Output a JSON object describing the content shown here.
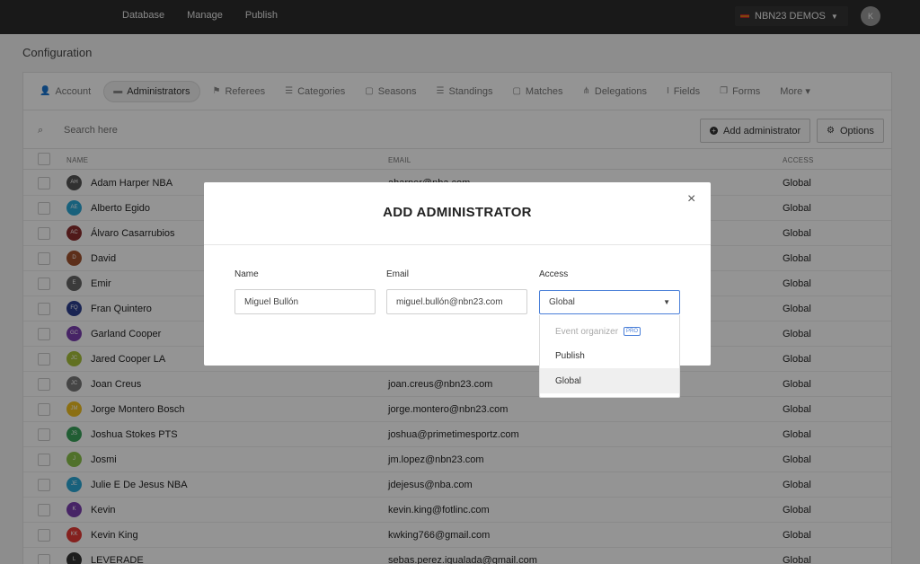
{
  "topnav": [
    "Database",
    "Manage",
    "Publish"
  ],
  "org": {
    "name": "NBN23 DEMOS"
  },
  "user": {
    "initials": "K"
  },
  "page": {
    "title": "Configuration"
  },
  "tabs": [
    {
      "icon": "person",
      "label": "Account"
    },
    {
      "icon": "briefcase",
      "label": "Administrators",
      "active": true
    },
    {
      "icon": "whistle",
      "label": "Referees"
    },
    {
      "icon": "list",
      "label": "Categories"
    },
    {
      "icon": "calendar",
      "label": "Seasons"
    },
    {
      "icon": "list",
      "label": "Standings"
    },
    {
      "icon": "calendar",
      "label": "Matches"
    },
    {
      "icon": "sitemap",
      "label": "Delegations"
    },
    {
      "icon": "i-beam",
      "label": "Fields"
    },
    {
      "icon": "copy",
      "label": "Forms"
    },
    {
      "icon": "",
      "label": "More ▾"
    }
  ],
  "toolbar": {
    "search_placeholder": "Search here",
    "add_label": "Add administrator",
    "options_label": "Options"
  },
  "table": {
    "headers": {
      "name": "NAME",
      "email": "EMAIL",
      "access": "ACCESS"
    },
    "rows": [
      {
        "initials": "AH",
        "color": "#555555",
        "name": "Adam Harper NBA",
        "email": "aharper@nba.com",
        "access": "Global"
      },
      {
        "initials": "AE",
        "color": "#2aa7d6",
        "name": "Alberto Egido",
        "email": "",
        "access": "Global"
      },
      {
        "initials": "AC",
        "color": "#8b2e2e",
        "name": "Álvaro Casarrubios",
        "email": "",
        "access": "Global"
      },
      {
        "initials": "D",
        "color": "#a0522d",
        "name": "David",
        "email": "",
        "access": "Global"
      },
      {
        "initials": "E",
        "color": "#666666",
        "name": "Emir",
        "email": "",
        "access": "Global"
      },
      {
        "initials": "FQ",
        "color": "#2c3e90",
        "name": "Fran Quintero",
        "email": "",
        "access": "Global"
      },
      {
        "initials": "GC",
        "color": "#7b3fb0",
        "name": "Garland Cooper",
        "email": "",
        "access": "Global"
      },
      {
        "initials": "JC",
        "color": "#a8c23a",
        "name": "Jared Cooper LA",
        "email": "",
        "access": "Global"
      },
      {
        "initials": "JC",
        "color": "#777777",
        "name": "Joan Creus",
        "email": "joan.creus@nbn23.com",
        "access": "Global"
      },
      {
        "initials": "JM",
        "color": "#f0c020",
        "name": "Jorge Montero Bosch",
        "email": "jorge.montero@nbn23.com",
        "access": "Global"
      },
      {
        "initials": "JS",
        "color": "#3aa35a",
        "name": "Joshua Stokes PTS",
        "email": "joshua@primetimesportz.com",
        "access": "Global"
      },
      {
        "initials": "J",
        "color": "#8bc34a",
        "name": "Josmi",
        "email": "jm.lopez@nbn23.com",
        "access": "Global"
      },
      {
        "initials": "JE",
        "color": "#2aa7d6",
        "name": "Julie E De Jesus NBA",
        "email": "jdejesus@nba.com",
        "access": "Global"
      },
      {
        "initials": "K",
        "color": "#7b3fb0",
        "name": "Kevin",
        "email": "kevin.king@fotlinc.com",
        "access": "Global"
      },
      {
        "initials": "KK",
        "color": "#e53935",
        "name": "Kevin King",
        "email": "kwking766@gmail.com",
        "access": "Global"
      },
      {
        "initials": "L",
        "color": "#333333",
        "name": "LEVERADE",
        "email": "sebas.perez.igualada@gmail.com",
        "access": "Global"
      }
    ]
  },
  "modal": {
    "title": "ADD ADMINISTRATOR",
    "close": "×",
    "name_label": "Name",
    "name_value": "Miguel Bullón",
    "email_label": "Email",
    "email_value": "miguel.bullón@nbn23.com",
    "access_label": "Access",
    "access_value": "Global",
    "options": [
      {
        "label": "Event organizer",
        "badge": "PRO",
        "disabled": true
      },
      {
        "label": "Publish"
      },
      {
        "label": "Global",
        "selected": true
      }
    ]
  }
}
